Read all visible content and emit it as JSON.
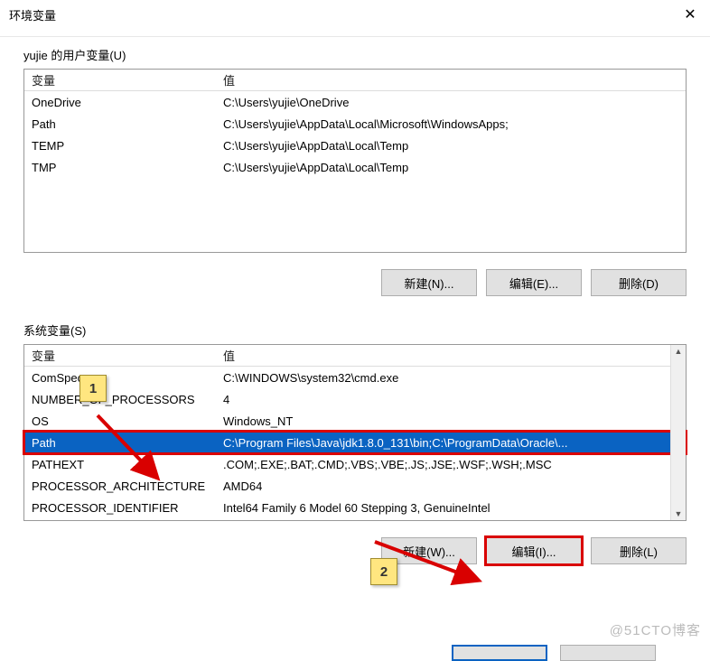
{
  "window": {
    "title": "环境变量",
    "close_glyph": "✕"
  },
  "user_section": {
    "label": "yujie 的用户变量(U)",
    "header_var": "变量",
    "header_val": "值",
    "rows": [
      {
        "var": "OneDrive",
        "val": "C:\\Users\\yujie\\OneDrive"
      },
      {
        "var": "Path",
        "val": "C:\\Users\\yujie\\AppData\\Local\\Microsoft\\WindowsApps;"
      },
      {
        "var": "TEMP",
        "val": "C:\\Users\\yujie\\AppData\\Local\\Temp"
      },
      {
        "var": "TMP",
        "val": "C:\\Users\\yujie\\AppData\\Local\\Temp"
      }
    ],
    "buttons": {
      "new": "新建(N)...",
      "edit": "编辑(E)...",
      "delete": "删除(D)"
    }
  },
  "sys_section": {
    "label": "系统变量(S)",
    "header_var": "变量",
    "header_val": "值",
    "rows": [
      {
        "var": "ComSpec",
        "val": "C:\\WINDOWS\\system32\\cmd.exe"
      },
      {
        "var": "NUMBER_OF_PROCESSORS",
        "val": "4"
      },
      {
        "var": "OS",
        "val": "Windows_NT"
      },
      {
        "var": "Path",
        "val": "C:\\Program Files\\Java\\jdk1.8.0_131\\bin;C:\\ProgramData\\Oracle\\...",
        "selected": true
      },
      {
        "var": "PATHEXT",
        "val": ".COM;.EXE;.BAT;.CMD;.VBS;.VBE;.JS;.JSE;.WSF;.WSH;.MSC"
      },
      {
        "var": "PROCESSOR_ARCHITECTURE",
        "val": "AMD64"
      },
      {
        "var": "PROCESSOR_IDENTIFIER",
        "val": "Intel64 Family 6 Model 60 Stepping 3, GenuineIntel"
      }
    ],
    "buttons": {
      "new": "新建(W)...",
      "edit": "编辑(I)...",
      "delete": "删除(L)"
    }
  },
  "annotations": {
    "step1": "1",
    "step2": "2"
  },
  "watermark": "@51CTO博客"
}
